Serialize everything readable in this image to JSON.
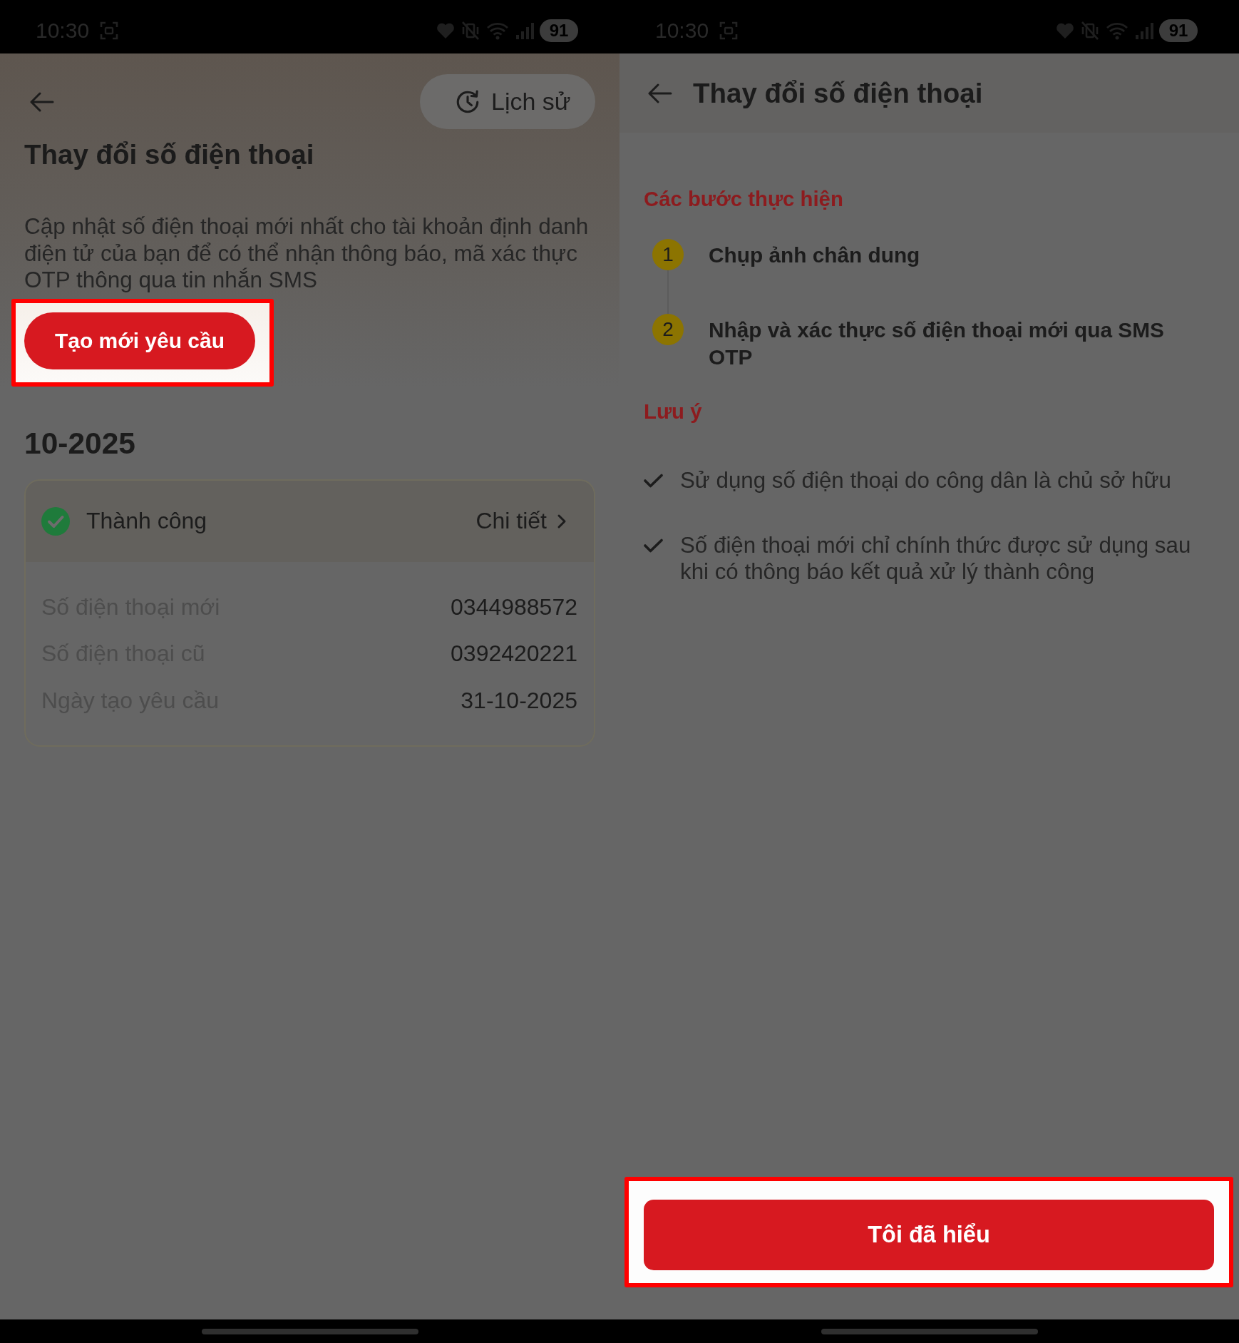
{
  "status_bars": [
    {
      "time": "10:30",
      "battery": "91"
    },
    {
      "time": "10:30",
      "battery": "91"
    }
  ],
  "history_screen": {
    "history_button": "Lịch sử",
    "title": "Thay đổi số điện thoại",
    "description": "Cập nhật số điện thoại mới nhất cho tài khoản định danh điện tử của bạn để có thể nhận thông báo, mã xác thực OTP thông qua tin nhắn SMS",
    "create_button": {
      "label": "Tạo mới yêu cầu",
      "highlighted": true
    },
    "month": "10-2025",
    "requests": [
      {
        "kind": "success",
        "status": "Thành công",
        "detail_link": "Chi tiết",
        "fields": [
          {
            "label": "Số điện thoại mới",
            "value": "0344988572"
          },
          {
            "label": "Số điện thoại cũ",
            "value": "0392420221"
          },
          {
            "label": "Ngày tạo yêu cầu",
            "value": "31-10-2025"
          }
        ]
      }
    ]
  },
  "guide_screen": {
    "title": "Thay đổi số điện thoại",
    "steps_heading": "Các bước thực hiện",
    "steps": [
      {
        "number": "1",
        "text": "Chụp ảnh chân dung"
      },
      {
        "number": "2",
        "text": "Nhập và xác thực số điện thoại mới qua SMS OTP"
      }
    ],
    "notes_heading": "Lưu ý",
    "notes": [
      "Sử dụng số điện thoại do công dân là chủ sở hữu",
      "Số điện thoại mới chỉ chính thức được sử dụng sau khi có thông báo kết quả xử lý thành công"
    ],
    "confirm_button": {
      "label": "Tôi đã hiểu",
      "highlighted": true
    }
  }
}
